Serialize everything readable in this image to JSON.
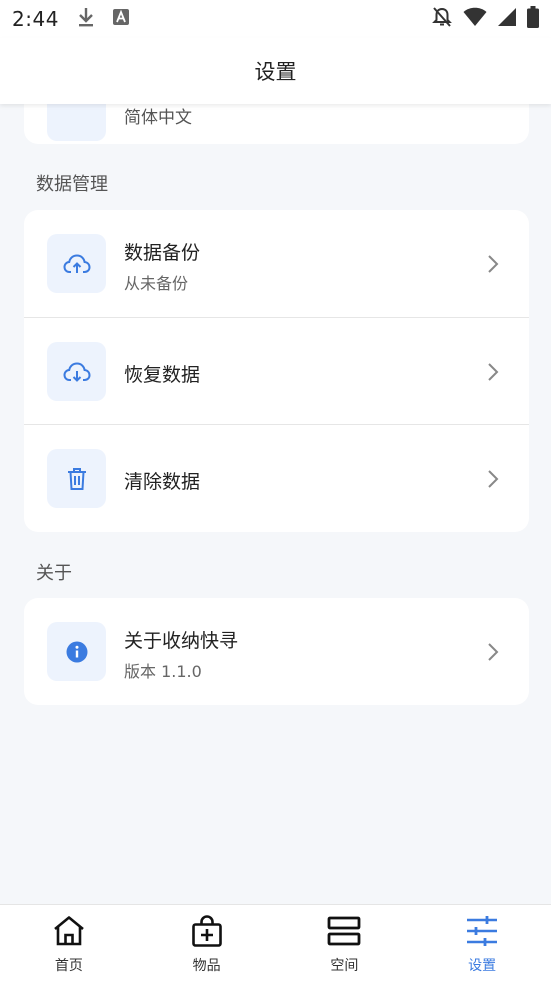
{
  "status_bar": {
    "time": "2:44"
  },
  "app_bar": {
    "title": "设置"
  },
  "language": {
    "value": "简体中文"
  },
  "data_section": {
    "title": "数据管理",
    "items": [
      {
        "title": "数据备份",
        "subtitle": "从未备份"
      },
      {
        "title": "恢复数据"
      },
      {
        "title": "清除数据"
      }
    ]
  },
  "about_section": {
    "title": "关于",
    "items": [
      {
        "title": "关于收纳快寻",
        "subtitle": "版本 1.1.0"
      }
    ]
  },
  "tabs": [
    {
      "label": "首页"
    },
    {
      "label": "物品"
    },
    {
      "label": "空间"
    },
    {
      "label": "设置",
      "active": true
    }
  ],
  "colors": {
    "accent": "#3b7be0",
    "icon_bg": "#edf3fd",
    "page_bg": "#f5f7fa"
  }
}
